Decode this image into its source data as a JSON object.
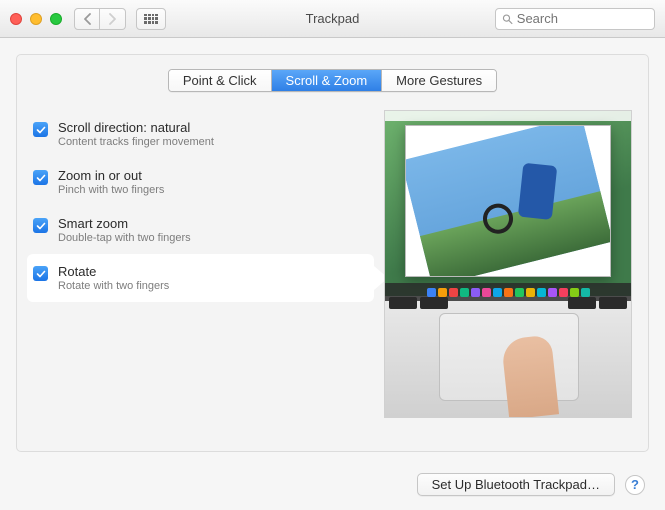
{
  "window": {
    "title": "Trackpad",
    "search_placeholder": "Search"
  },
  "tabs": [
    {
      "label": "Point & Click",
      "active": false
    },
    {
      "label": "Scroll & Zoom",
      "active": true
    },
    {
      "label": "More Gestures",
      "active": false
    }
  ],
  "options": [
    {
      "title": "Scroll direction: natural",
      "subtitle": "Content tracks finger movement",
      "checked": true,
      "selected": false
    },
    {
      "title": "Zoom in or out",
      "subtitle": "Pinch with two fingers",
      "checked": true,
      "selected": false
    },
    {
      "title": "Smart zoom",
      "subtitle": "Double-tap with two fingers",
      "checked": true,
      "selected": false
    },
    {
      "title": "Rotate",
      "subtitle": "Rotate with two fingers",
      "checked": true,
      "selected": true
    }
  ],
  "footer": {
    "setup_button": "Set Up Bluetooth Trackpad…",
    "help_label": "?"
  },
  "dock_colors": [
    "#3b82f6",
    "#f59e0b",
    "#ef4444",
    "#10b981",
    "#8b5cf6",
    "#ec4899",
    "#0ea5e9",
    "#f97316",
    "#22c55e",
    "#eab308",
    "#06b6d4",
    "#a855f7",
    "#f43f5e",
    "#84cc16",
    "#14b8a6"
  ]
}
